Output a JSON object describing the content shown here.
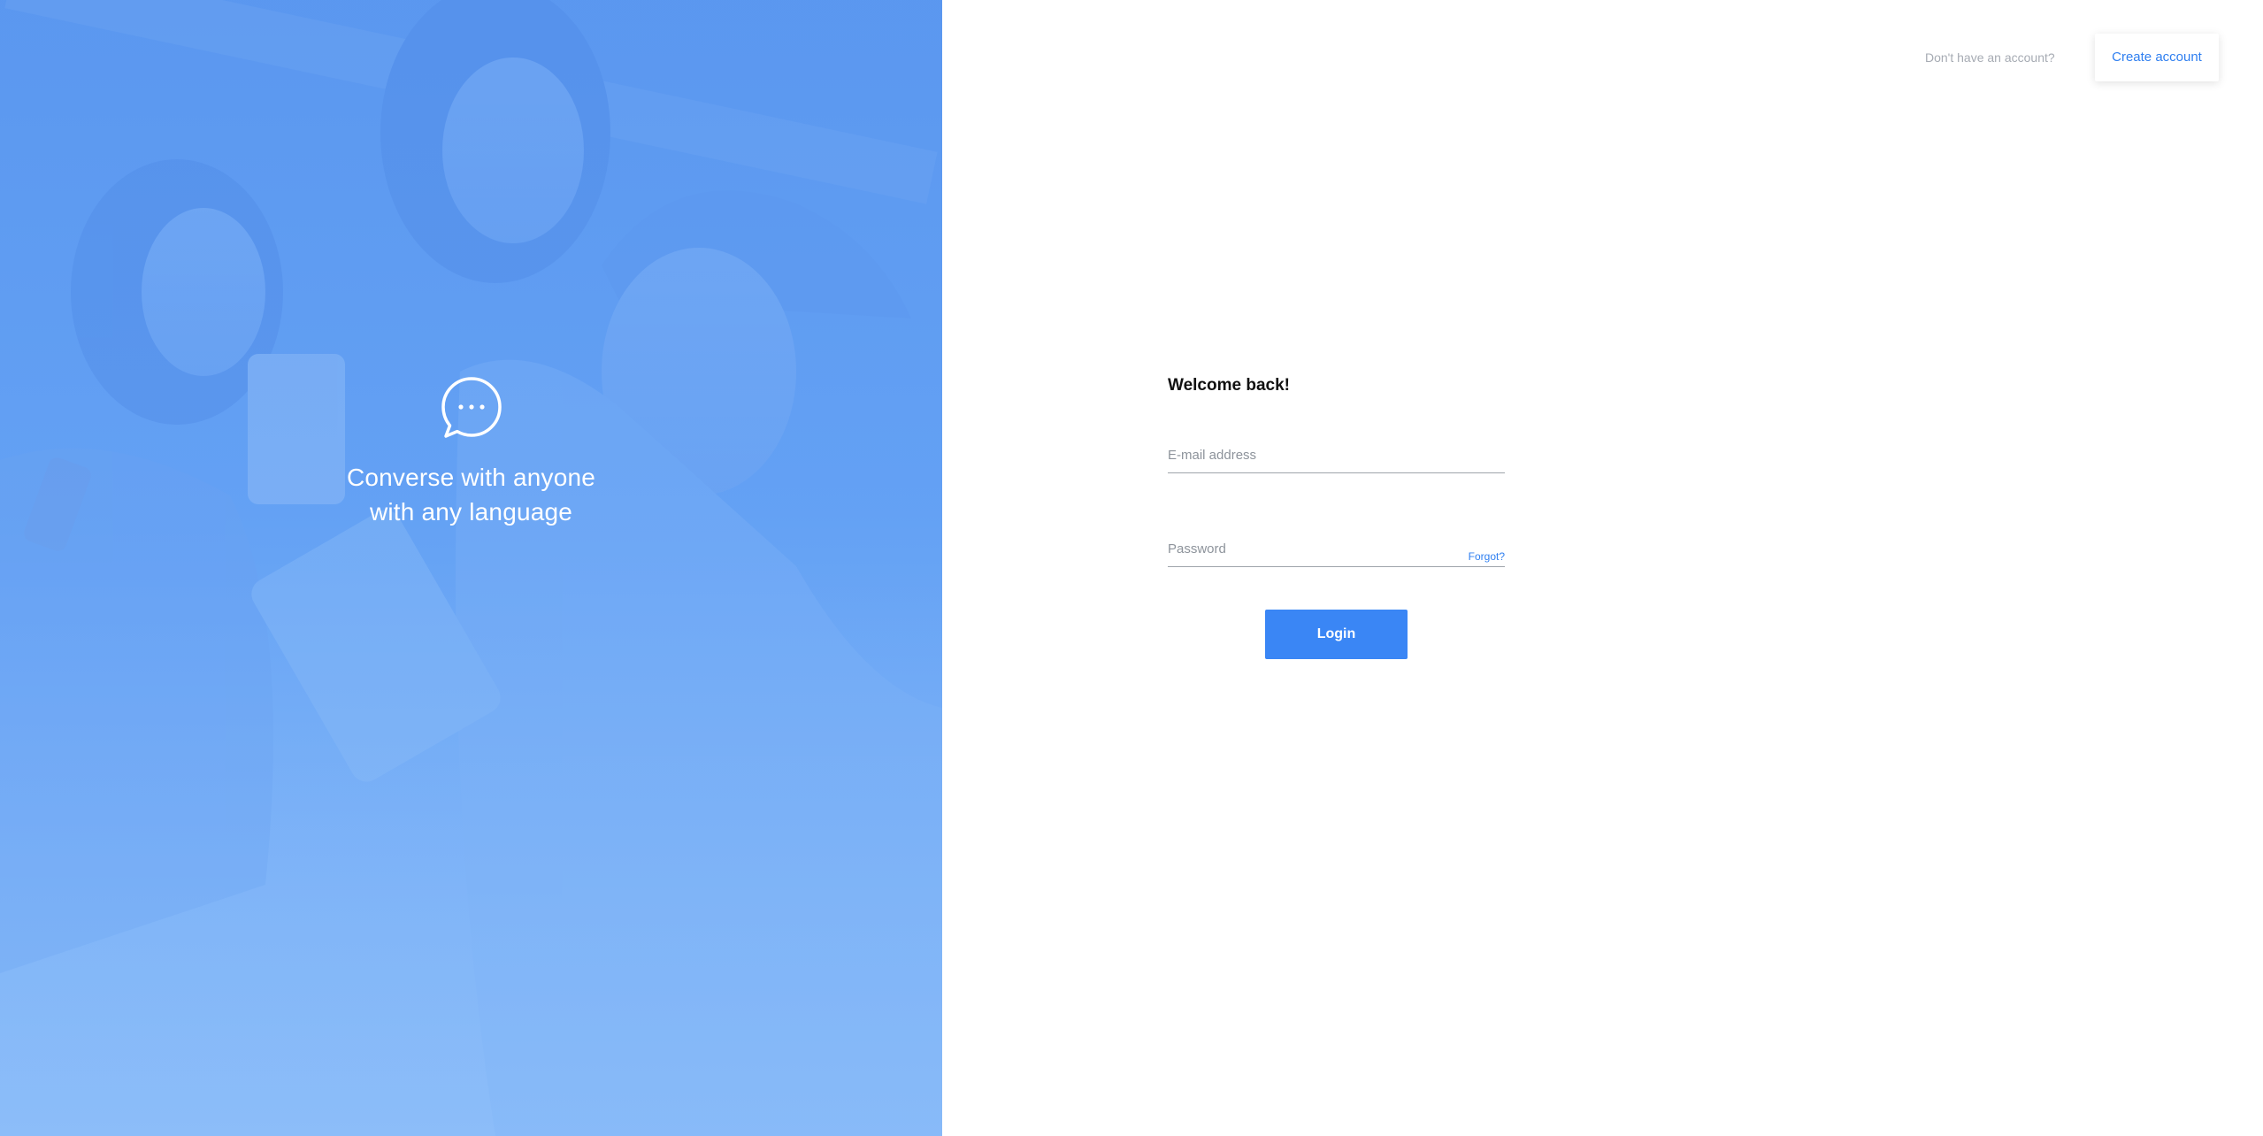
{
  "hero": {
    "icon": "chat-bubble-icon",
    "tagline_line1": "Converse with anyone",
    "tagline_line2": "with any language"
  },
  "header": {
    "prompt": "Don't have an account?",
    "create_account_label": "Create account"
  },
  "form": {
    "title": "Welcome back!",
    "email_placeholder": "E-mail address",
    "password_placeholder": "Password",
    "forgot_label": "Forgot?",
    "login_label": "Login"
  },
  "colors": {
    "accent": "#3a86f5",
    "hero_blue": "#5b98ef",
    "muted_text": "#a6abb3"
  }
}
